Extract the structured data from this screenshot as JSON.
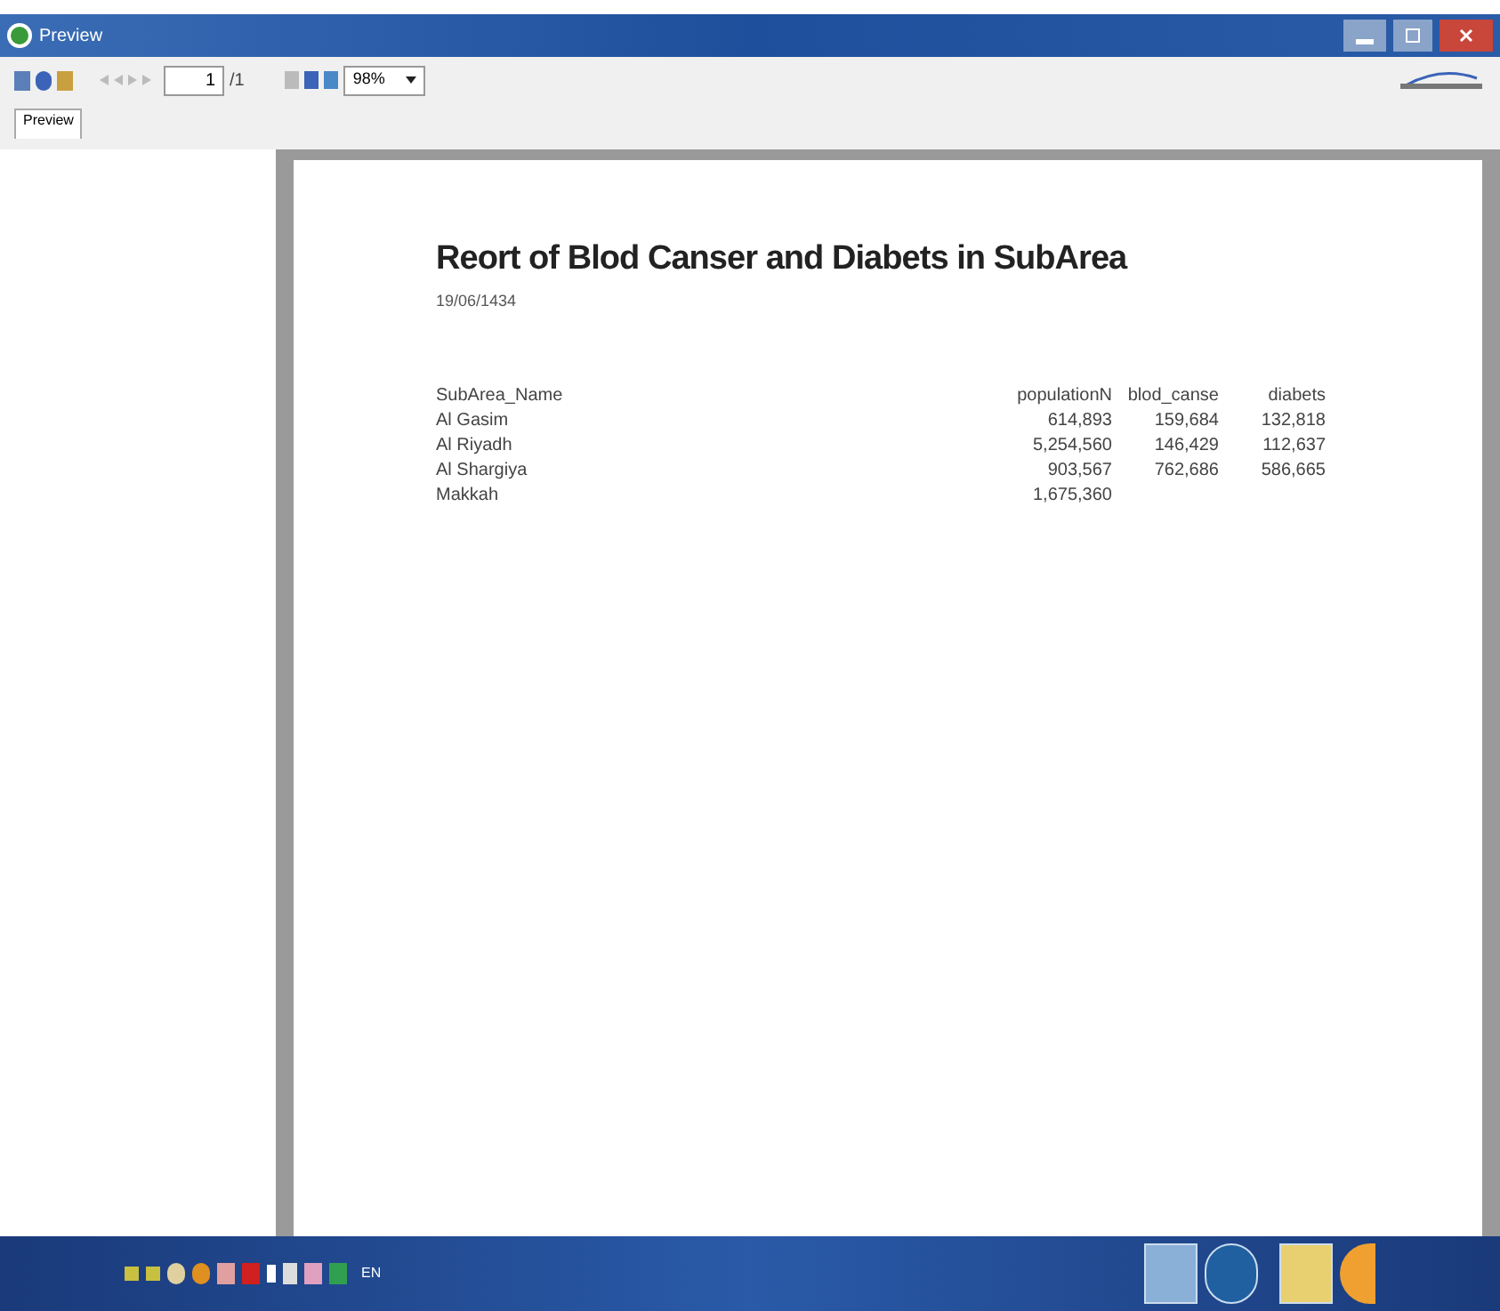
{
  "window": {
    "title": "Preview"
  },
  "toolbar": {
    "page_field": "1",
    "page_total": "/1",
    "zoom": "98%"
  },
  "tabs": [
    {
      "label": "Preview",
      "selected": true
    }
  ],
  "report": {
    "title": "Reort of Blod Canser and Diabets in SubArea",
    "date": "19/06/1434",
    "columns": [
      "SubArea_Name",
      "populationN",
      "blod_canse",
      "diabets"
    ],
    "rows": [
      [
        "Al Gasim",
        "614,893",
        "159,684",
        "132,818"
      ],
      [
        "Al Riyadh",
        "5,254,560",
        "146,429",
        "112,637"
      ],
      [
        "Al Shargiya",
        "903,567",
        "762,686",
        "586,665"
      ],
      [
        "Makkah",
        "1,675,360",
        "",
        ""
      ]
    ]
  },
  "taskbar": {
    "language": "EN"
  }
}
